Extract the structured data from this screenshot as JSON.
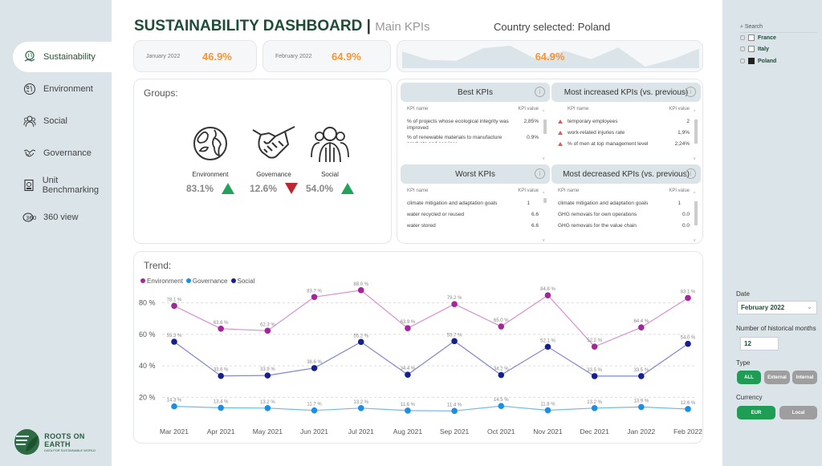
{
  "nav": {
    "items": [
      {
        "label": "Sustainability",
        "icon": "globe-hand-icon",
        "active": true
      },
      {
        "label": "Environment",
        "icon": "earth-leaf-icon",
        "active": false
      },
      {
        "label": "Social",
        "icon": "people-icon",
        "active": false
      },
      {
        "label": "Governance",
        "icon": "handshake-icon",
        "active": false
      },
      {
        "label": "Unit Benchmarking",
        "icon": "report-icon",
        "active": false
      },
      {
        "label": "360 view",
        "icon": "360-icon",
        "active": false
      }
    ],
    "logo": {
      "name": "ROOTS ON EARTH",
      "tagline": "DATA FOR SUSTAINABLE WORLD"
    }
  },
  "header": {
    "title": "SUSTAINABILITY DASHBOARD",
    "separator": "|",
    "subtitle": "Main KPIs",
    "country_selected": "Country selected: Poland"
  },
  "kpis": {
    "previous": {
      "label": "January 2022",
      "value": "46.9%"
    },
    "current": {
      "label": "February 2022",
      "value": "64.9%"
    },
    "sparkline": {
      "value": "64.9%",
      "series": [
        78.1,
        63.6,
        62.3,
        83.7,
        88.0,
        63.9,
        79.2,
        65.0,
        84.8,
        52.2,
        64.4,
        83.1
      ]
    }
  },
  "groups": {
    "title": "Groups:",
    "items": [
      {
        "name": "Environment",
        "value": "83.1%",
        "trend": "up",
        "icon": "earth-leaf-icon"
      },
      {
        "name": "Governance",
        "value": "12.6%",
        "trend": "down",
        "icon": "handshake-icon"
      },
      {
        "name": "Social",
        "value": "54.0%",
        "trend": "up",
        "icon": "people-icon"
      }
    ]
  },
  "tables": {
    "col_name": "KPI name",
    "col_value": "KPI value",
    "info": "i",
    "best": {
      "title": "Best KPIs",
      "rows": [
        {
          "name": "% of projects whose ecological integrity was improved",
          "value": "2,85%"
        },
        {
          "name": "% of renewable materials to manufacture products and services",
          "value": "0.9%"
        }
      ]
    },
    "increased": {
      "title": "Most increased KPIs (vs. previous)",
      "rows": [
        {
          "name": "temporary employees",
          "value": "2"
        },
        {
          "name": "work-related injuries rate",
          "value": "1,9%"
        },
        {
          "name": "% of men at top management level",
          "value": "2,24%"
        }
      ]
    },
    "worst": {
      "title": "Worst KPIs",
      "rows": [
        {
          "name": "climate mitigation and adaptation goals",
          "value": "1"
        },
        {
          "name": "water recycled or reused",
          "value": "6.6"
        },
        {
          "name": "water stored",
          "value": "6.6"
        }
      ]
    },
    "decreased": {
      "title": "Most decreased KPIs (vs. previous)",
      "rows": [
        {
          "name": "climate mitigation and adaptation goals",
          "value": "1"
        },
        {
          "name": "GHG removals for own operations",
          "value": "0.0"
        },
        {
          "name": "GHG removals for the value chain",
          "value": "0.0"
        }
      ]
    }
  },
  "chart_data": {
    "type": "line",
    "title": "Trend:",
    "categories": [
      "Mar 2021",
      "Apr 2021",
      "May 2021",
      "Jun 2021",
      "Jul 2021",
      "Aug 2021",
      "Sep 2021",
      "Oct 2021",
      "Nov 2021",
      "Dec 2021",
      "Jan 2022",
      "Feb 2022"
    ],
    "series": [
      {
        "name": "Environment",
        "color": "#a3279b",
        "values": [
          78.1,
          63.6,
          62.3,
          83.7,
          88.0,
          63.9,
          79.2,
          65.0,
          84.8,
          52.2,
          64.4,
          83.1
        ]
      },
      {
        "name": "Governance",
        "color": "#1b8fe8",
        "values": [
          14.3,
          13.4,
          13.2,
          11.7,
          13.2,
          11.6,
          11.4,
          14.5,
          11.8,
          13.2,
          13.9,
          12.6
        ]
      },
      {
        "name": "Social",
        "color": "#15208f",
        "values": [
          55.3,
          33.6,
          33.9,
          38.6,
          55.2,
          34.4,
          55.7,
          34.2,
          52.1,
          33.5,
          33.5,
          54.0
        ]
      }
    ],
    "yticks": [
      "20 %",
      "40 %",
      "60 %",
      "80 %"
    ],
    "ytick_values": [
      20,
      40,
      60,
      80
    ],
    "ylim": [
      8,
      92
    ],
    "grid": true,
    "legend": "top-left",
    "label_suffix": " %"
  },
  "filters": {
    "search_placeholder": "Search",
    "countries": [
      {
        "name": "France",
        "checked": false
      },
      {
        "name": "Italy",
        "checked": false
      },
      {
        "name": "Poland",
        "checked": true
      }
    ],
    "date_label": "Date",
    "date_value": "February 2022",
    "months_label": "Number of historical months",
    "months_value": "12",
    "type_label": "Type",
    "type_options": [
      {
        "label": "ALL",
        "selected": true
      },
      {
        "label": "External",
        "selected": false
      },
      {
        "label": "Internal",
        "selected": false
      }
    ],
    "currency_label": "Currency",
    "currency_options": [
      {
        "label": "EUR",
        "selected": true
      },
      {
        "label": "Local",
        "selected": false
      }
    ]
  }
}
